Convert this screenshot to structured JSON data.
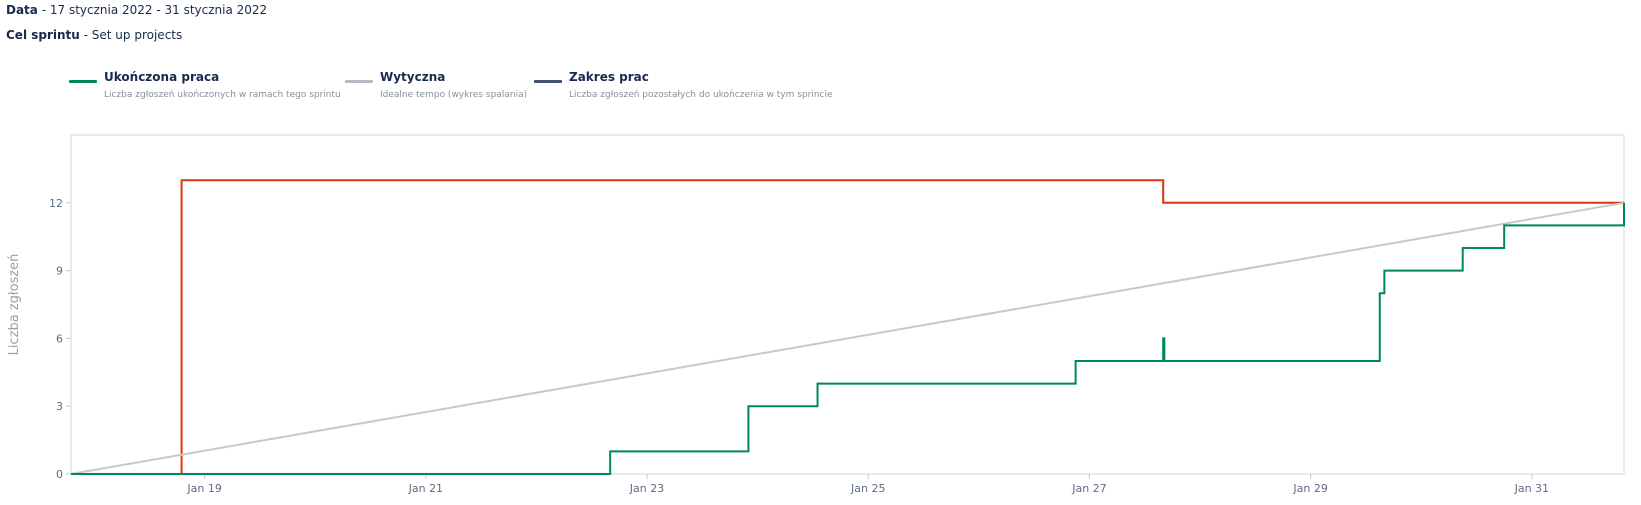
{
  "header": {
    "date_key": "Data",
    "date_value": " - 17 stycznia 2022 - 31 stycznia 2022",
    "goal_key": "Cel sprintu",
    "goal_value": " - Set up projects"
  },
  "legend": [
    {
      "title": "Ukończona praca",
      "description": "Liczba zgłoszeń ukończonych w ramach tego sprintu",
      "color": "#00875a"
    },
    {
      "title": "Wytyczna",
      "description": "Idealne tempo (wykres spalania)",
      "color": "#b3bac5"
    },
    {
      "title": "Zakres prac",
      "description": "Liczba zgłoszeń pozostałych do ukończenia w tym sprincie",
      "color": "#42526e"
    }
  ],
  "chart_data": {
    "type": "line",
    "ylabel": "Liczba zgłoszeń",
    "xlabel": "",
    "x_ticks": [
      "Jan 19",
      "Jan 21",
      "Jan 23",
      "Jan 25",
      "Jan 27",
      "Jan 29",
      "Jan 31"
    ],
    "x_tick_dates": [
      "2022-01-19",
      "2022-01-21",
      "2022-01-23",
      "2022-01-25",
      "2022-01-27",
      "2022-01-29",
      "2022-01-31"
    ],
    "y_ticks": [
      0,
      3,
      6,
      9,
      12
    ],
    "xlim": [
      "2022-01-17T19:00",
      "2022-01-31T20:00"
    ],
    "ylim": [
      0,
      15
    ],
    "series": [
      {
        "name": "Zakres prac",
        "color": "#de350b",
        "step": true,
        "points": [
          [
            "2022-01-17T19:00",
            0
          ],
          [
            "2022-01-18T19:00",
            13
          ],
          [
            "2022-01-27T16:00",
            12
          ],
          [
            "2022-01-31T20:00",
            12
          ]
        ]
      },
      {
        "name": "Wytyczna",
        "color": "#c8c8c8",
        "step": false,
        "points": [
          [
            "2022-01-17T19:00",
            0
          ],
          [
            "2022-01-31T20:00",
            12
          ]
        ]
      },
      {
        "name": "Ukończona praca",
        "color": "#00875a",
        "step": true,
        "points": [
          [
            "2022-01-17T19:00",
            0
          ],
          [
            "2022-01-22T16:00",
            1
          ],
          [
            "2022-01-23T22:00",
            3
          ],
          [
            "2022-01-24T13:00",
            4
          ],
          [
            "2022-01-26T21:00",
            5
          ],
          [
            "2022-01-27T16:00",
            6
          ],
          [
            "2022-01-27T16:15",
            5
          ],
          [
            "2022-01-29T15:00",
            8
          ],
          [
            "2022-01-29T16:00",
            9
          ],
          [
            "2022-01-30T09:00",
            10
          ],
          [
            "2022-01-30T18:00",
            11
          ],
          [
            "2022-01-31T20:00",
            12
          ]
        ]
      }
    ]
  }
}
